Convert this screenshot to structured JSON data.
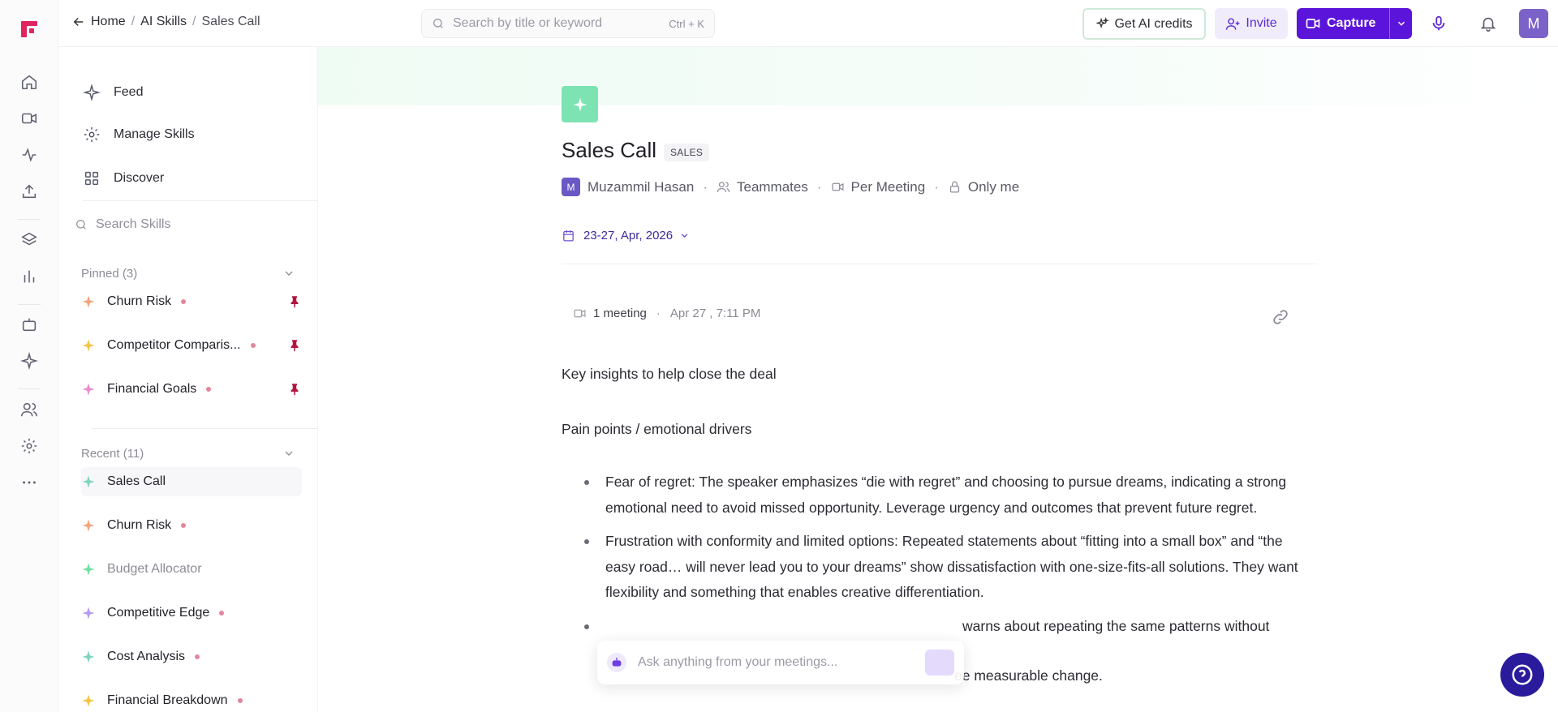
{
  "breadcrumb": {
    "home": "Home",
    "section": "AI Skills",
    "current": "Sales Call"
  },
  "search": {
    "placeholder": "Search by title or keyword",
    "shortcut": "Ctrl + K"
  },
  "topbar": {
    "credits_label": "Get AI credits",
    "invite_label": "Invite",
    "capture_label": "Capture",
    "avatar_initial": "M"
  },
  "sidebar": {
    "nav": [
      {
        "label": "Feed",
        "icon": "sparkle-icon"
      },
      {
        "label": "Manage Skills",
        "icon": "gear-icon"
      },
      {
        "label": "Discover",
        "icon": "grid-icon"
      }
    ],
    "search_placeholder": "Search Skills",
    "pinned": {
      "label": "Pinned (3)",
      "items": [
        {
          "label": "Churn Risk",
          "color": "#f0a67a",
          "pinned": true
        },
        {
          "label": "Competitor Comparis...",
          "color": "#f4c542",
          "pinned": true
        },
        {
          "label": "Financial Goals",
          "color": "#e98bd1",
          "pinned": true
        }
      ]
    },
    "recent": {
      "label": "Recent (11)",
      "items": [
        {
          "label": "Sales Call",
          "color": "#7ed6bd"
        },
        {
          "label": "Churn Risk",
          "color": "#f0a67a"
        },
        {
          "label": "Budget Allocator",
          "color": "#6fe0a4"
        },
        {
          "label": "Competitive Edge",
          "color": "#b49cf0"
        },
        {
          "label": "Cost Analysis",
          "color": "#7fd3c1"
        },
        {
          "label": "Financial Breakdown",
          "color": "#f4c542"
        }
      ]
    }
  },
  "skill": {
    "title": "Sales Call",
    "tag": "SALES",
    "owner_initial": "M",
    "owner": "Muzammil Hasan",
    "audience": "Teammates",
    "frequency": "Per Meeting",
    "visibility": "Only me",
    "date_range": "23-27, Apr, 2026",
    "accent": "#7ee3b3"
  },
  "meeting": {
    "count": "1 meeting",
    "when": "Apr 27 , 7:11 PM"
  },
  "content": {
    "intro": "Key insights to help close the deal",
    "heading": "Pain points / emotional drivers",
    "bullets": [
      "Fear of regret: The speaker emphasizes “die with regret” and choosing to pursue dreams, indicating a strong emotional need to avoid missed opportunity. Leverage urgency and outcomes that prevent future regret.",
      "Frustration with conformity and limited options: Repeated statements about “fitting into a small box” and “the easy road… will never lead you to your dreams” show dissatisfaction with one-size-fits-all solutions. They want flexibility and something that enables creative differentiation.",
      "warns about repeating the same patterns without",
      "ee measurable change."
    ]
  },
  "askbar": {
    "placeholder": "Ask anything from your meetings..."
  }
}
